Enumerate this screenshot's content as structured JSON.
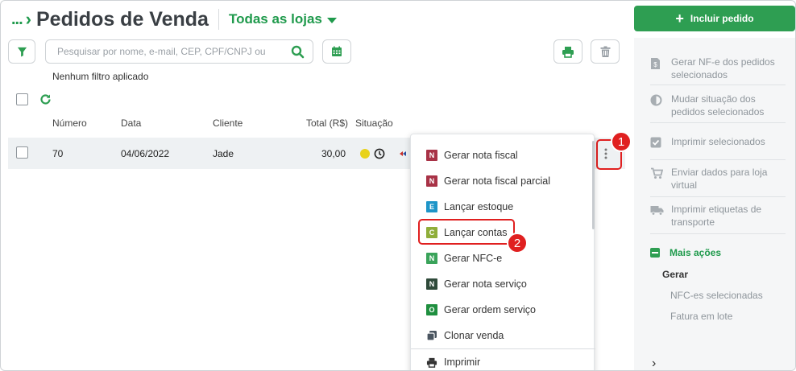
{
  "header": {
    "breadcrumb_dots": "...",
    "title": "Pedidos de Venda",
    "store_selector": "Todas as lojas"
  },
  "actions": {
    "add_order_label": "Incluir pedido"
  },
  "search": {
    "placeholder": "Pesquisar por nome, e-mail, CEP, CPF/CNPJ ou"
  },
  "filter_status": "Nenhum filtro aplicado",
  "table": {
    "headers": {
      "number": "Número",
      "date": "Data",
      "client": "Cliente",
      "total": "Total (R$)",
      "status": "Situação"
    },
    "rows": [
      {
        "number": "70",
        "date": "04/06/2022",
        "client": "Jade",
        "total": "30,00"
      }
    ]
  },
  "context_menu": {
    "items": [
      {
        "badge": "N",
        "label": "Gerar nota fiscal"
      },
      {
        "badge": "N",
        "label": "Gerar nota fiscal parcial"
      },
      {
        "badge": "E",
        "label": "Lançar estoque"
      },
      {
        "badge": "C",
        "label": "Lançar contas"
      },
      {
        "badge": "N",
        "label": "Gerar NFC-e"
      },
      {
        "badge": "N",
        "label": "Gerar nota serviço"
      },
      {
        "badge": "O",
        "label": "Gerar ordem serviço"
      },
      {
        "badge": "",
        "label": "Clonar venda"
      },
      {
        "badge": "",
        "label": "Imprimir"
      }
    ]
  },
  "annotations": {
    "step1": "1",
    "step2": "2"
  },
  "side_panel": {
    "items": [
      {
        "label": "Gerar NF-e dos pedidos selecionados",
        "icon": "invoice-icon"
      },
      {
        "label": "Mudar situação dos pedidos selecionados",
        "icon": "half-circle-icon"
      },
      {
        "label": "Imprimir selecionados",
        "icon": "checkbox-icon"
      },
      {
        "label": "Enviar dados para loja virtual",
        "icon": "cart-icon"
      },
      {
        "label": "Imprimir etiquetas de transporte",
        "icon": "truck-icon"
      }
    ],
    "more_actions": "Mais ações",
    "section_title": "Gerar",
    "sub_items": [
      "NFC-es selecionadas",
      "Fatura em lote"
    ]
  },
  "colors": {
    "brand_green": "#2e9e52",
    "highlight_red": "#e02020",
    "badge_n_red": "#a83246",
    "badge_e_blue": "#1e95c8",
    "badge_c_olive": "#8fae3a",
    "badge_n_green": "#3aa35a",
    "badge_n_dark": "#2f4a3a",
    "badge_o_green": "#1f8f3f",
    "status_yellow": "#e8d21a"
  }
}
